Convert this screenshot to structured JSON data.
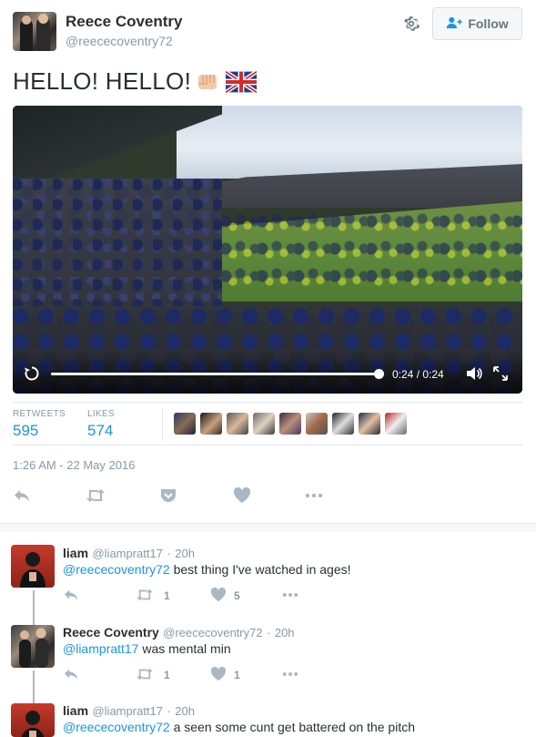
{
  "tweet": {
    "author_name": "Reece Coventry",
    "author_handle": "@reececoventry72",
    "follow_label": "Follow",
    "text": "HELLO! HELLO!",
    "video": {
      "time": "0:24 / 0:24",
      "progress_fraction": 1.0
    },
    "stats": {
      "retweets_label": "RETWEETS",
      "retweets_value": "595",
      "likes_label": "LIKES",
      "likes_value": "574"
    },
    "datetime": "1:26 AM - 22 May 2016"
  },
  "replies": [
    {
      "name": "liam",
      "handle": "@liampratt17",
      "age": "20h",
      "mention": "@reececoventry72",
      "text": " best thing I've watched in ages!",
      "retweets": "1",
      "likes": "5"
    },
    {
      "name": "Reece Coventry",
      "handle": "@reececoventry72",
      "age": "20h",
      "mention": "@liampratt17",
      "text": " was mental min",
      "retweets": "1",
      "likes": "1"
    },
    {
      "name": "liam",
      "handle": "@liampratt17",
      "age": "20h",
      "mention": "@reececoventry72",
      "text": " a seen some cunt get battered on the pitch"
    }
  ],
  "colors": {
    "link_blue": "#1b95e0",
    "muted_gray": "#8899a6",
    "divider": "#e1e8ed"
  },
  "icons": {
    "settings": "gear-icon",
    "follow": "add-user-icon",
    "replay": "replay-icon",
    "volume": "volume-icon",
    "fullscreen": "fullscreen-icon",
    "reply": "reply-icon",
    "retweet": "retweet-icon",
    "pocket": "pocket-icon",
    "like": "heart-icon",
    "more": "more-icon"
  }
}
